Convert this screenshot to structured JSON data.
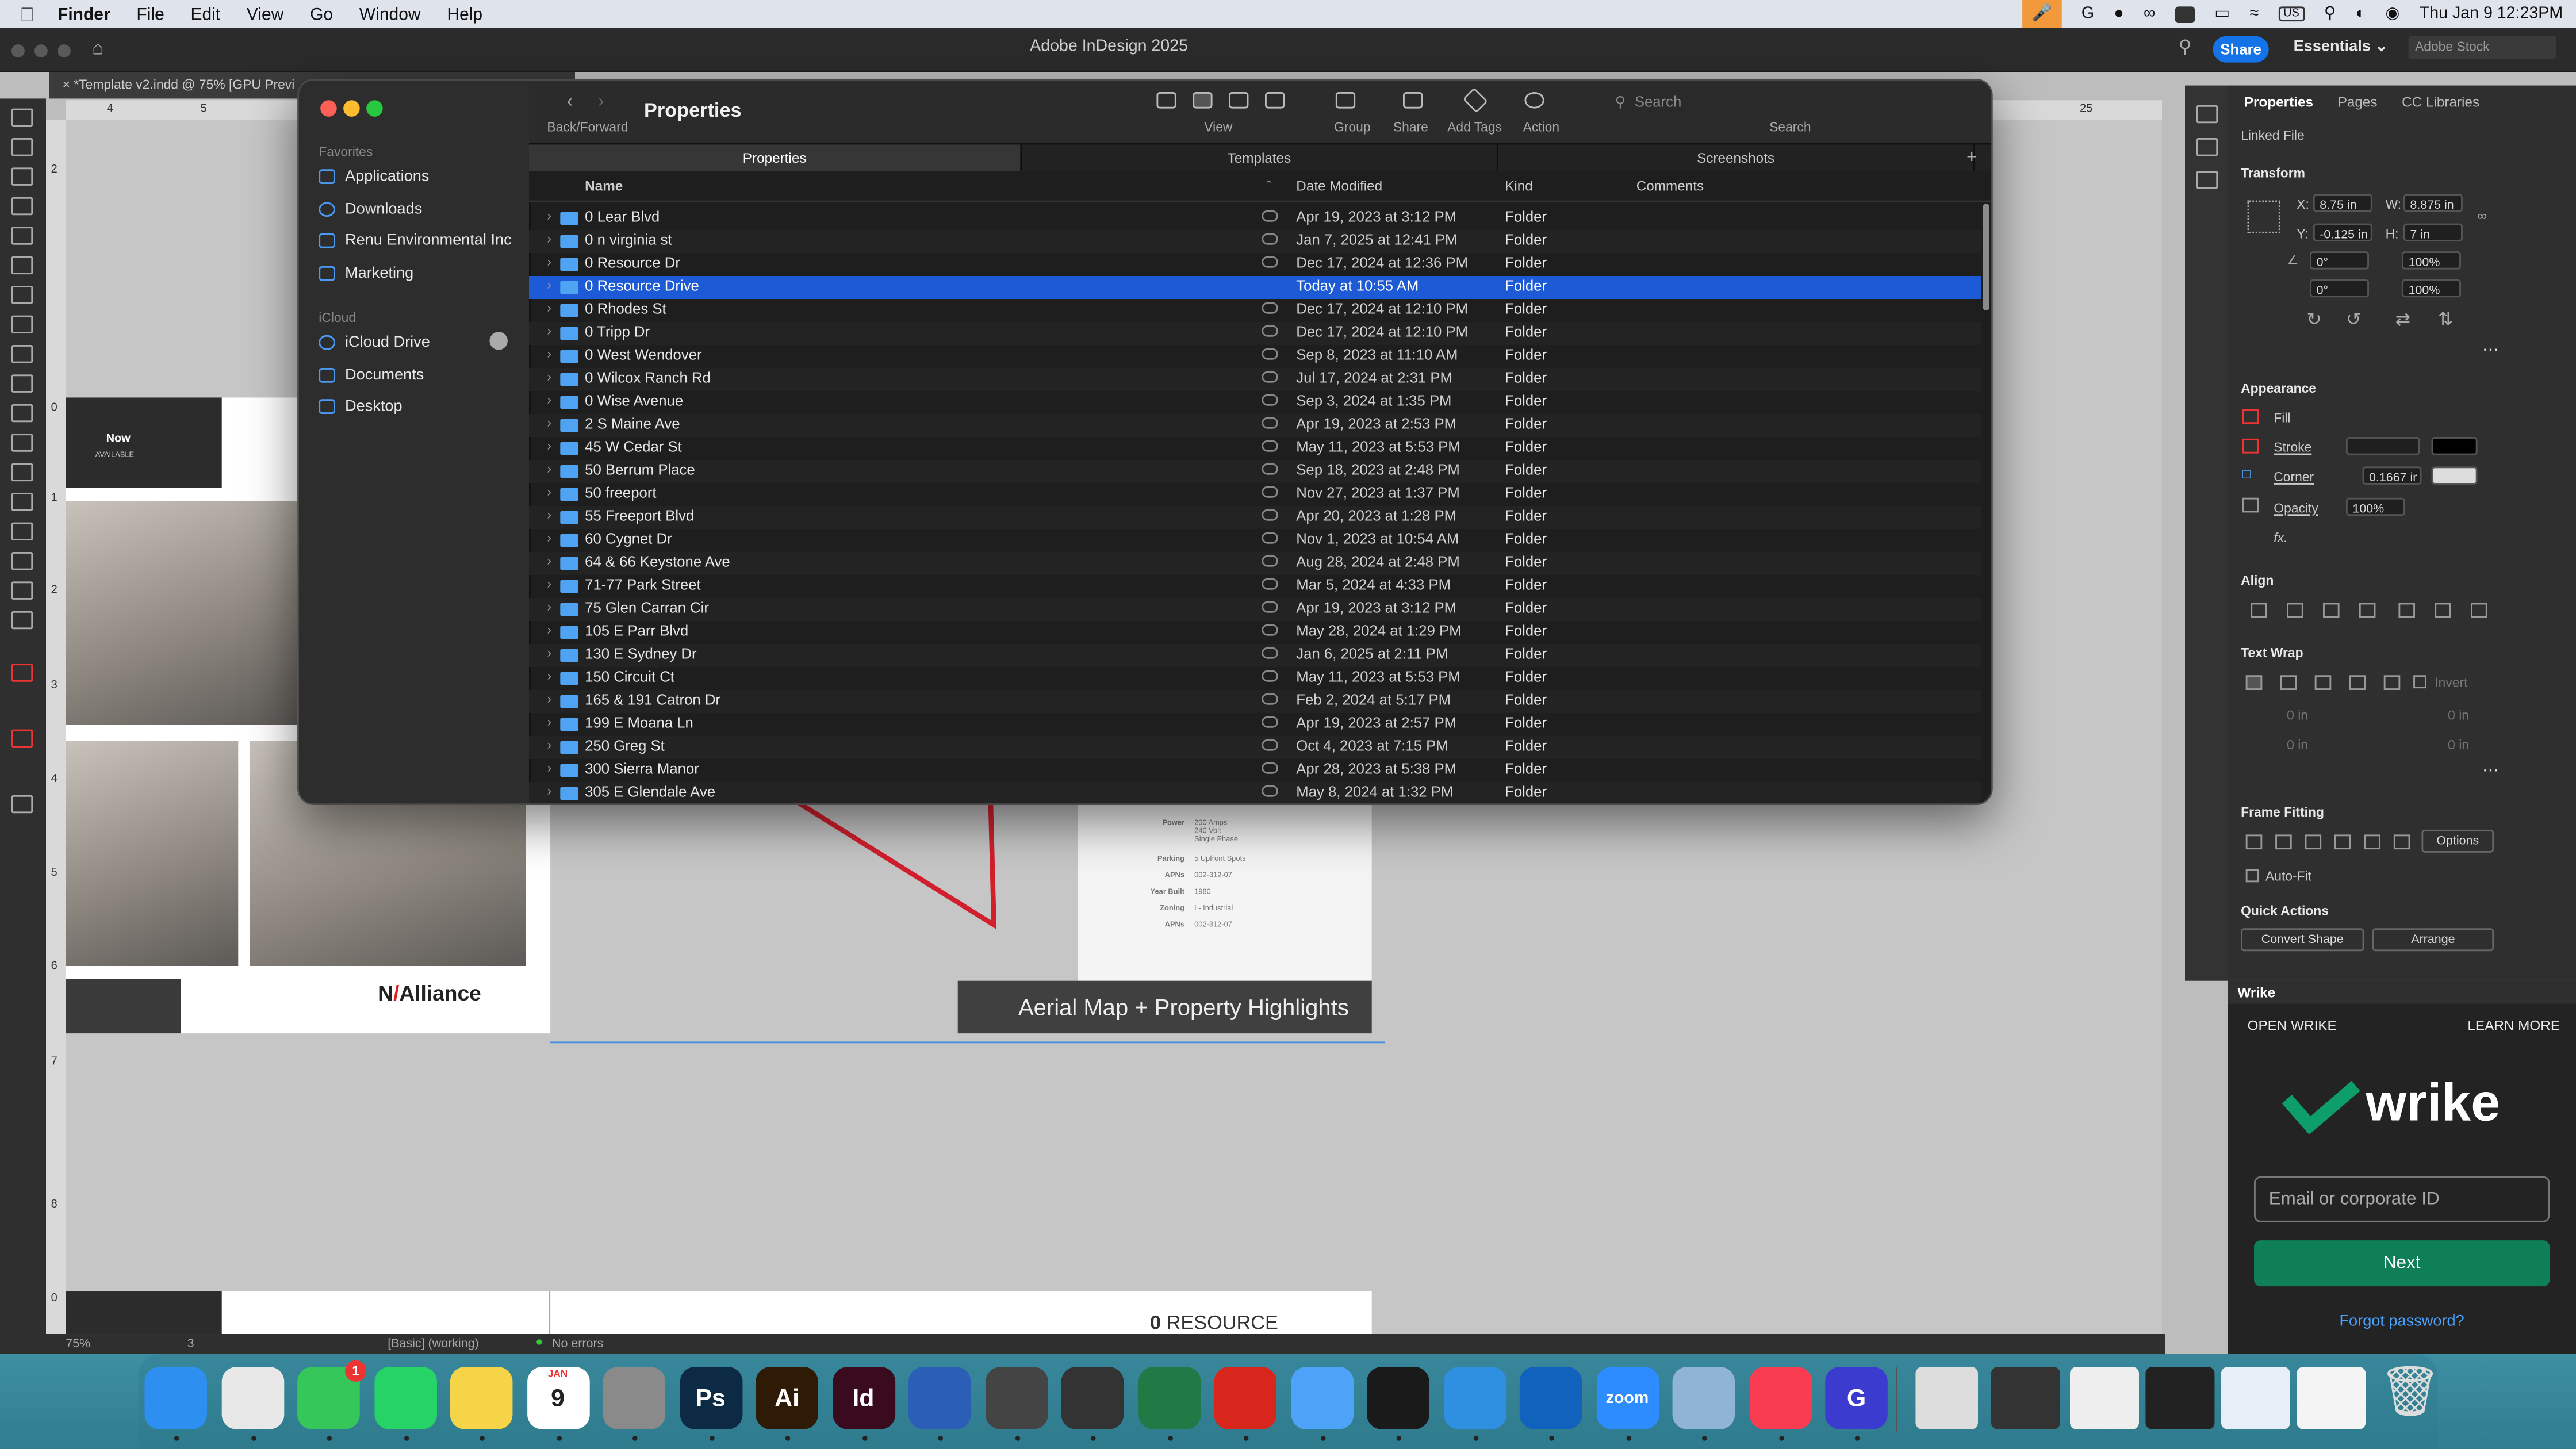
{
  "menubar": {
    "app": "Finder",
    "items": [
      "File",
      "Edit",
      "View",
      "Go",
      "Window",
      "Help"
    ],
    "clock": "Thu Jan 9  12:23PM",
    "input_source": "US"
  },
  "indesign": {
    "window_title": "Adobe InDesign 2025",
    "share_label": "Share",
    "workspace": "Essentials",
    "stock_placeholder": "Adobe Stock",
    "doc_tab": "*Template v2.indd @ 75% [GPU Previ",
    "ruler_top": [
      "4",
      "5",
      "25"
    ],
    "ruler_left": [
      "2",
      "0",
      "1",
      "2",
      "3",
      "4",
      "5",
      "6",
      "7",
      "8",
      "0"
    ],
    "page": {
      "badge_line1": "Now",
      "badge_line2": "AVAILABLE",
      "brand": "Alliance",
      "aerial_caption": "Aerial Map + Property Highlights",
      "specs": [
        {
          "k": "Power",
          "v": "200 Amps\n240 Volt\nSingle Phase"
        },
        {
          "k": "Parking",
          "v": "5 Upfront Spots"
        },
        {
          "k": "APNs",
          "v": "002-312-07"
        },
        {
          "k": "Year Built",
          "v": "1980"
        },
        {
          "k": "Zoning",
          "v": "I - Industrial"
        },
        {
          "k": "APNs",
          "v": "002-312-07"
        }
      ],
      "footer_text": "RESOURCE"
    },
    "status": {
      "zoom": "75%",
      "page": "3",
      "style": "[Basic] (working)",
      "errors": "No errors"
    }
  },
  "properties_panel": {
    "tabs": [
      "Properties",
      "Pages",
      "CC Libraries"
    ],
    "linked_file": "Linked File",
    "transform": {
      "title": "Transform",
      "x_label": "X:",
      "x": "8.75 in",
      "y_label": "Y:",
      "y": "-0.125 in",
      "w_label": "W:",
      "w": "8.875 in",
      "h_label": "H:",
      "h": "7 in",
      "rotate": "0°",
      "shear": "0°",
      "scale_x": "100%",
      "scale_y": "100%"
    },
    "appearance": {
      "title": "Appearance",
      "fill": "Fill",
      "stroke": "Stroke",
      "corner": "Corner",
      "corner_value": "0.1667 ir",
      "opacity": "Opacity",
      "opacity_value": "100%",
      "fx": "fx."
    },
    "align_title": "Align",
    "text_wrap": {
      "title": "Text Wrap",
      "invert": "Invert",
      "offsets": [
        "0 in",
        "0 in",
        "0 in",
        "0 in"
      ]
    },
    "frame_fitting": {
      "title": "Frame Fitting",
      "options": "Options",
      "auto_fit": "Auto-Fit"
    },
    "quick_actions": {
      "title": "Quick Actions",
      "convert": "Convert Shape",
      "arrange": "Arrange"
    }
  },
  "wrike": {
    "panel_title": "Wrike",
    "open": "OPEN WRIKE",
    "learn": "LEARN MORE",
    "logo_text": "wrike",
    "input_placeholder": "Email or corporate ID",
    "next": "Next",
    "forgot": "Forgot password?",
    "brand_color": "#0e7f57"
  },
  "finder": {
    "title": "Properties",
    "nav_label": "Back/Forward",
    "toolbar": {
      "view": "View",
      "group": "Group",
      "share": "Share",
      "add_tags": "Add Tags",
      "action": "Action",
      "search_placeholder": "Search",
      "search_label": "Search"
    },
    "sidebar": {
      "favorites_head": "Favorites",
      "favorites": [
        "Applications",
        "Downloads",
        "Renu Environmental Inc",
        "Marketing"
      ],
      "icloud_head": "iCloud",
      "icloud": [
        "iCloud Drive",
        "Documents",
        "Desktop"
      ]
    },
    "tabs": [
      "Properties",
      "Templates",
      "Screenshots"
    ],
    "columns": {
      "name": "Name",
      "date": "Date Modified",
      "kind": "Kind",
      "comments": "Comments"
    },
    "selected_index": 3,
    "rows": [
      {
        "name": "0 Lear Blvd",
        "date": "Apr 19, 2023 at 3:12 PM",
        "kind": "Folder"
      },
      {
        "name": "0 n virginia st",
        "date": "Jan 7, 2025 at 12:41 PM",
        "kind": "Folder"
      },
      {
        "name": "0 Resource Dr",
        "date": "Dec 17, 2024 at 12:36 PM",
        "kind": "Folder"
      },
      {
        "name": "0 Resource Drive",
        "date": "Today at 10:55 AM",
        "kind": "Folder"
      },
      {
        "name": "0 Rhodes St",
        "date": "Dec 17, 2024 at 12:10 PM",
        "kind": "Folder"
      },
      {
        "name": "0 Tripp Dr",
        "date": "Dec 17, 2024 at 12:10 PM",
        "kind": "Folder"
      },
      {
        "name": "0 West Wendover",
        "date": "Sep 8, 2023 at 11:10 AM",
        "kind": "Folder"
      },
      {
        "name": "0 Wilcox Ranch Rd",
        "date": "Jul 17, 2024 at 2:31 PM",
        "kind": "Folder"
      },
      {
        "name": "0 Wise Avenue",
        "date": "Sep 3, 2024 at 1:35 PM",
        "kind": "Folder"
      },
      {
        "name": "2 S Maine Ave",
        "date": "Apr 19, 2023 at 2:53 PM",
        "kind": "Folder"
      },
      {
        "name": "45 W Cedar St",
        "date": "May 11, 2023 at 5:53 PM",
        "kind": "Folder"
      },
      {
        "name": "50 Berrum Place",
        "date": "Sep 18, 2023 at 2:48 PM",
        "kind": "Folder"
      },
      {
        "name": "50 freeport",
        "date": "Nov 27, 2023 at 1:37 PM",
        "kind": "Folder"
      },
      {
        "name": "55 Freeport Blvd",
        "date": "Apr 20, 2023 at 1:28 PM",
        "kind": "Folder"
      },
      {
        "name": "60 Cygnet Dr",
        "date": "Nov 1, 2023 at 10:54 AM",
        "kind": "Folder"
      },
      {
        "name": "64 & 66 Keystone Ave",
        "date": "Aug 28, 2024 at 2:48 PM",
        "kind": "Folder"
      },
      {
        "name": "71-77 Park Street",
        "date": "Mar 5, 2024 at 4:33 PM",
        "kind": "Folder"
      },
      {
        "name": "75 Glen Carran Cir",
        "date": "Apr 19, 2023 at 3:12 PM",
        "kind": "Folder"
      },
      {
        "name": "105 E Parr Blvd",
        "date": "May 28, 2024 at 1:29 PM",
        "kind": "Folder"
      },
      {
        "name": "130 E Sydney Dr",
        "date": "Jan 6, 2025 at 2:11 PM",
        "kind": "Folder"
      },
      {
        "name": "150 Circuit Ct",
        "date": "May 11, 2023 at 5:53 PM",
        "kind": "Folder"
      },
      {
        "name": "165 & 191 Catron Dr",
        "date": "Feb 2, 2024 at 5:17 PM",
        "kind": "Folder"
      },
      {
        "name": "199 E Moana Ln",
        "date": "Apr 19, 2023 at 2:57 PM",
        "kind": "Folder"
      },
      {
        "name": "250 Greg St",
        "date": "Oct 4, 2023 at 7:15 PM",
        "kind": "Folder"
      },
      {
        "name": "300 Sierra Manor",
        "date": "Apr 28, 2023 at 5:38 PM",
        "kind": "Folder"
      },
      {
        "name": "305 E Glendale Ave",
        "date": "May 8, 2024 at 1:32 PM",
        "kind": "Folder"
      }
    ]
  },
  "dock": {
    "apps": [
      {
        "name": "finder-icon",
        "label": "",
        "color": "#2d8ff0"
      },
      {
        "name": "chrome-icon",
        "label": "",
        "color": "#e8e8e8"
      },
      {
        "name": "messages-icon",
        "label": "",
        "color": "#35c759"
      },
      {
        "name": "whatsapp-icon",
        "label": "",
        "color": "#25d366"
      },
      {
        "name": "notes-icon",
        "label": "",
        "color": "#f5d547"
      },
      {
        "name": "calendar-icon",
        "label": "9",
        "color": "#ffffff"
      },
      {
        "name": "settings-icon",
        "label": "",
        "color": "#8a8a8a"
      },
      {
        "name": "photoshop-icon",
        "label": "Ps",
        "color": "#0c2a44"
      },
      {
        "name": "illustrator-icon",
        "label": "Ai",
        "color": "#2f1a06"
      },
      {
        "name": "indesign-icon",
        "label": "Id",
        "color": "#3a0b1e"
      },
      {
        "name": "word-icon",
        "label": "",
        "color": "#2b5eb7"
      },
      {
        "name": "screenshot-icon",
        "label": "",
        "color": "#444"
      },
      {
        "name": "calculator-icon",
        "label": "",
        "color": "#333"
      },
      {
        "name": "excel-icon",
        "label": "",
        "color": "#1f7a45"
      },
      {
        "name": "acrobat-icon",
        "label": "",
        "color": "#d8261d"
      },
      {
        "name": "mail-icon",
        "label": "",
        "color": "#4da3f7"
      },
      {
        "name": "activity-monitor-icon",
        "label": "",
        "color": "#1a1a1a"
      },
      {
        "name": "readdle-icon",
        "label": "",
        "color": "#2f8fe0"
      },
      {
        "name": "outlook-icon",
        "label": "",
        "color": "#1062bd"
      },
      {
        "name": "zoom-icon",
        "label": "zoom",
        "color": "#2d8cff"
      },
      {
        "name": "preview-icon",
        "label": "",
        "color": "#8fb4d6"
      },
      {
        "name": "music-icon",
        "label": "",
        "color": "#fa3c52"
      },
      {
        "name": "grammarly-icon",
        "label": "G",
        "color": "#3b3bd0"
      }
    ],
    "messages_badge": "1",
    "calendar_month": "JAN"
  }
}
